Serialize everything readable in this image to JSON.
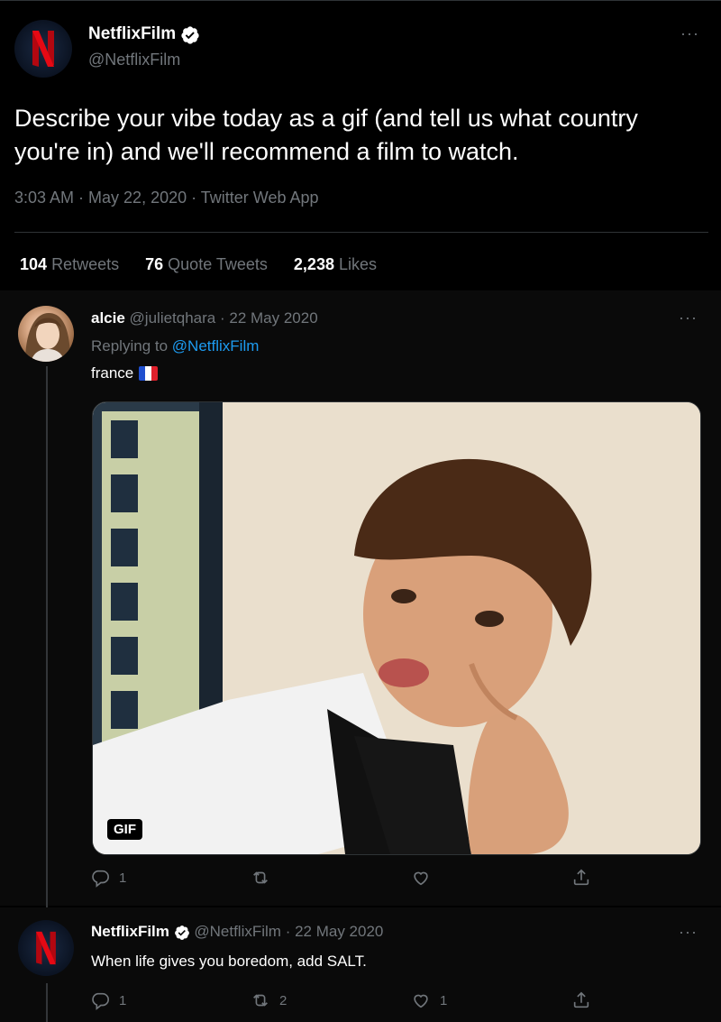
{
  "main_tweet": {
    "author": {
      "name": "NetflixFilm",
      "handle": "@NetflixFilm"
    },
    "text": "Describe your vibe today as a gif (and tell us what country you're in) and we'll recommend a film to watch.",
    "meta": "3:03 AM · May 22, 2020 · Twitter Web App",
    "stats": {
      "retweets": {
        "count": "104",
        "label": "Retweets"
      },
      "quotes": {
        "count": "76",
        "label": "Quote Tweets"
      },
      "likes": {
        "count": "2,238",
        "label": "Likes"
      }
    },
    "more": "···"
  },
  "reply1": {
    "author": {
      "name": "alcie",
      "handle": "@julietqhara",
      "date": "· 22 May 2020"
    },
    "replying_prefix": "Replying to",
    "replying_to": "@NetflixFilm",
    "text": "france",
    "media_badge": "GIF",
    "counts": {
      "reply": "1",
      "retweet": "",
      "like": ""
    },
    "more": "···"
  },
  "reply2": {
    "author": {
      "name": "NetflixFilm",
      "handle": "@NetflixFilm",
      "date": "· 22 May 2020"
    },
    "text": "When life gives you boredom, add SALT.",
    "counts": {
      "reply": "1",
      "retweet": "2",
      "like": "1"
    },
    "more": "···"
  },
  "colors": {
    "accent": "#1d9bf0",
    "netflix_red": "#e50914",
    "muted": "#71767b",
    "background": "#000000"
  },
  "icons": [
    "verified-badge-icon",
    "reply-icon",
    "retweet-icon",
    "like-icon",
    "share-icon",
    "more-icon",
    "flag-france-icon"
  ]
}
